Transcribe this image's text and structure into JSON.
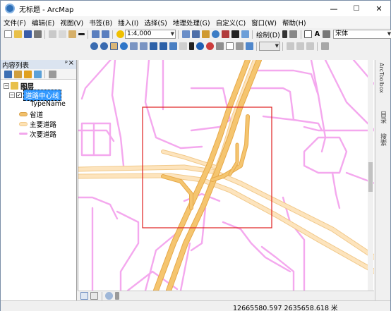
{
  "window": {
    "title": "无标题 - ArcMap",
    "controls": {
      "minimize": "—",
      "maximize": "☐",
      "close": "✕"
    }
  },
  "menubar": {
    "items": [
      "文件(F)",
      "编辑(E)",
      "视图(V)",
      "书签(B)",
      "插入(I)",
      "选择(S)",
      "地理处理(G)",
      "自定义(C)",
      "窗口(W)",
      "帮助(H)"
    ]
  },
  "toolbar": {
    "scale_value": "1:4,000",
    "draw_label": "绘制(D)",
    "font_value": "宋体",
    "text_tool": "A"
  },
  "toc": {
    "title": "内容列表",
    "pin": "ᵖ",
    "close": "×",
    "layers_label": "图层",
    "layer_name": "道路中心线",
    "field_name": "TypeName",
    "classes": [
      {
        "label": "省道",
        "color": "#f2c16c"
      },
      {
        "label": "主要道路",
        "color": "#fde2b4"
      },
      {
        "label": "次要道路",
        "color": "#f2a6ec"
      }
    ]
  },
  "right_tabs": [
    "ArcToolbox",
    "目录",
    "搜索"
  ],
  "map": {
    "colors": {
      "provincial": "#f5c56f",
      "provincial_edge": "#e6a94a",
      "major": "#fde4bd",
      "minor": "#f4a8ee",
      "selection_box": "#e02020"
    }
  },
  "status": {
    "coordinates": "12665580.597  2635658.618 米"
  }
}
